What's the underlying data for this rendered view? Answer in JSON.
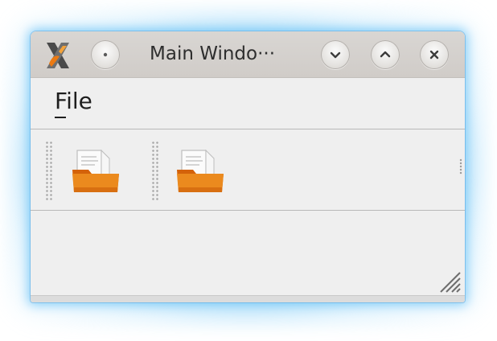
{
  "window": {
    "title": "Main Windo···",
    "app_icon": "x-app-icon",
    "buttons": [
      {
        "name": "window-menu-button",
        "icon": "circle-icon"
      },
      {
        "name": "minimize-button",
        "icon": "chevron-down-icon"
      },
      {
        "name": "maximize-button",
        "icon": "chevron-up-icon"
      },
      {
        "name": "close-button",
        "icon": "close-icon"
      }
    ]
  },
  "menubar": {
    "file_label": "File",
    "file_mnemonic": "F"
  },
  "toolbar": {
    "items": [
      {
        "name": "open-file-button",
        "icon": "folder-open-icon"
      },
      {
        "name": "open-file-button-2",
        "icon": "folder-open-icon"
      }
    ]
  },
  "colors": {
    "glow": "#7ccaf6",
    "titlebar": "#d4d0cc",
    "folder": "#e67f16"
  }
}
